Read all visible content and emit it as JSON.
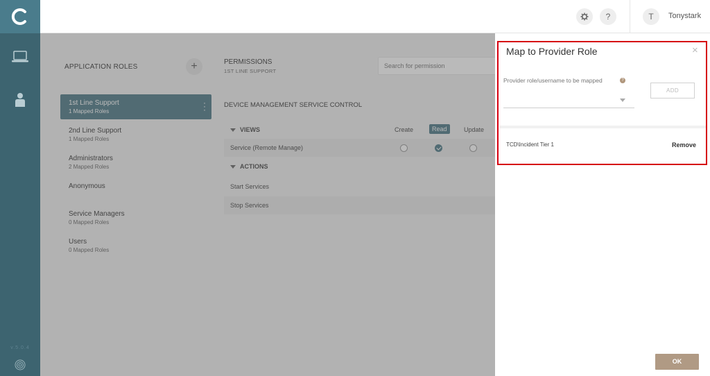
{
  "header": {
    "help_label": "?",
    "user_initial": "T",
    "user_name": "Tonystark"
  },
  "rail": {
    "version": "v.5.0.4"
  },
  "roles": {
    "title": "APPLICATION ROLES",
    "add_label": "+",
    "items": [
      {
        "name": "1st Line Support",
        "sub": "1 Mapped Roles",
        "active": true
      },
      {
        "name": "2nd Line Support",
        "sub": "1 Mapped Roles"
      },
      {
        "name": "Administrators",
        "sub": "2 Mapped Roles"
      },
      {
        "name": "Anonymous",
        "sub": ""
      },
      {
        "name": "Service Managers",
        "sub": "0 Mapped Roles"
      },
      {
        "name": "Users",
        "sub": "0 Mapped Roles"
      }
    ]
  },
  "permissions": {
    "title": "PERMISSIONS",
    "subtitle": "1ST LINE SUPPORT",
    "search_placeholder": "Search for permission",
    "group_title": "DEVICE MANAGEMENT SERVICE CONTROL",
    "columns": [
      "Create",
      "Read",
      "Update"
    ],
    "active_column": "Read",
    "rows": [
      {
        "label": "VIEWS",
        "type": "section"
      },
      {
        "label": "Service (Remote Manage)",
        "type": "item",
        "checked": "Read"
      },
      {
        "label": "ACTIONS",
        "type": "section"
      },
      {
        "label": "Start Services",
        "type": "item"
      },
      {
        "label": "Stop Services",
        "type": "item"
      }
    ]
  },
  "dialog": {
    "title": "Map to Provider Role",
    "close_label": "×",
    "field_label": "Provider role/username to be mapped",
    "help_label": "?",
    "add_label": "ADD",
    "mapped": [
      {
        "name": "TCD\\Incident Tier 1",
        "remove_label": "Remove"
      }
    ],
    "ok_label": "OK"
  },
  "colors": {
    "rail": "#3d6470",
    "accent": "#4b7886",
    "highlight": "#d6000f",
    "ok_button": "#b09a84"
  }
}
